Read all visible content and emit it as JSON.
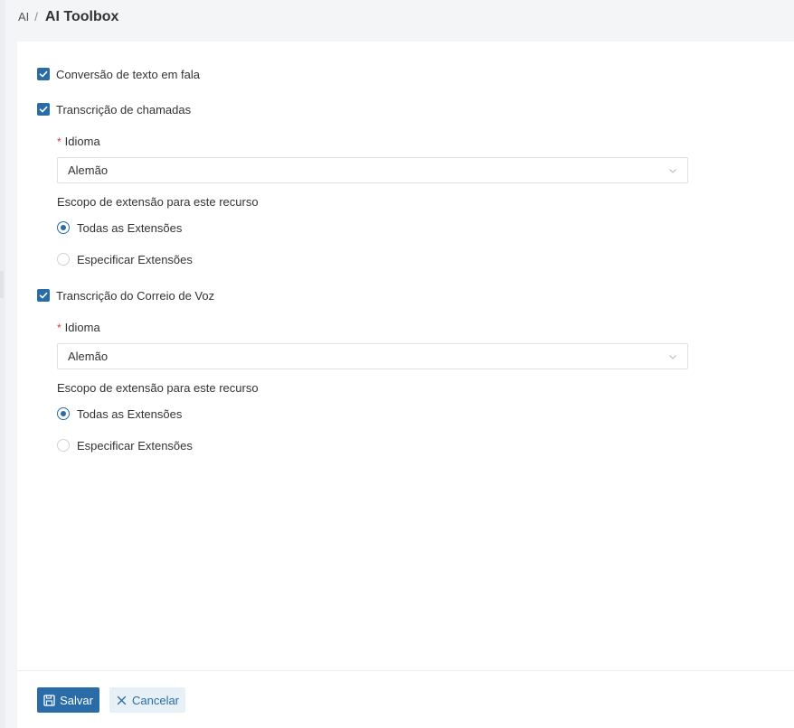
{
  "breadcrumb": {
    "parent": "AI",
    "separator": "/",
    "title": "AI Toolbox"
  },
  "features": {
    "tts": {
      "label": "Conversão de texto em fala",
      "checked": true
    },
    "call_transcription": {
      "label": "Transcrição de chamadas",
      "checked": true,
      "language_label": "Idioma",
      "language_value": "Alemão",
      "scope_label": "Escopo de extensão para este recurso",
      "scope_options": [
        "Todas as Extensões",
        "Especificar Extensões"
      ],
      "scope_selected": "Todas as Extensões"
    },
    "voicemail_transcription": {
      "label": "Transcrição do Correio de Voz",
      "checked": true,
      "language_label": "Idioma",
      "language_value": "Alemão",
      "scope_label": "Escopo de extensão para este recurso",
      "scope_options": [
        "Todas as Extensões",
        "Especificar Extensões"
      ],
      "scope_selected": "Todas as Extensões"
    }
  },
  "footer": {
    "save_label": "Salvar",
    "cancel_label": "Cancelar"
  },
  "colors": {
    "accent": "#2a6ca8",
    "required": "#d9363e",
    "cancel_bg": "#e8f0f7"
  },
  "icons": {
    "check": "check-icon",
    "chevron": "chevron-down-icon",
    "save": "floppy-disk-icon",
    "cancel": "close-icon"
  }
}
